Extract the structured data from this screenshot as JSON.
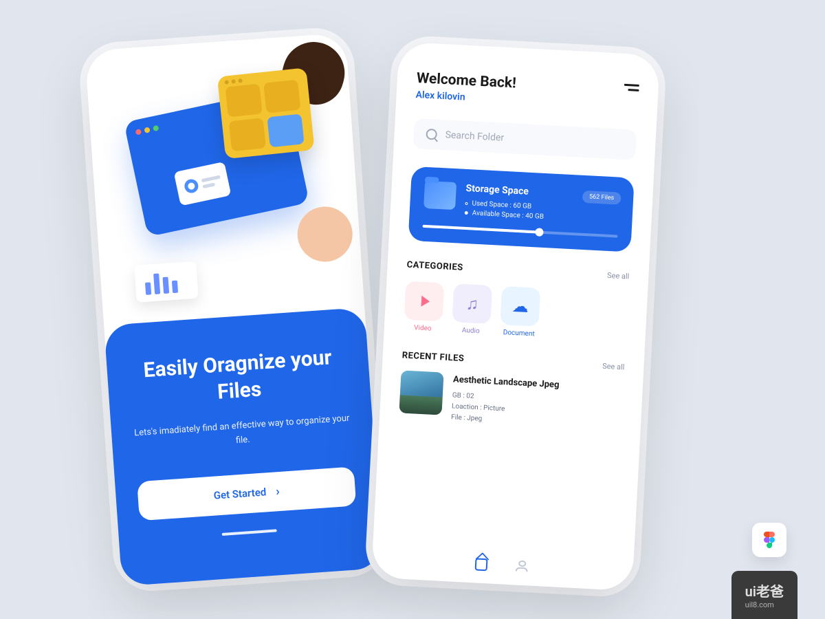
{
  "onboarding": {
    "title": "Easily Oragnize your Files",
    "subtitle": "Lets's imadiately find an effective way to organize your file.",
    "button_label": "Get Started"
  },
  "home": {
    "welcome": "Welcome Back!",
    "username": "Alex kilovin",
    "search_placeholder": "Search  Folder",
    "storage": {
      "title": "Storage Space",
      "used_label": "Used Space : 60 GB",
      "available_label": "Available Space : 40 GB",
      "badge": "562 Files",
      "percent": 60
    },
    "categories_title": "CATEGORIES",
    "see_all": "See all",
    "categories": [
      {
        "label": "Video"
      },
      {
        "label": "Audio"
      },
      {
        "label": "Document"
      }
    ],
    "recent_title": "RECENT FILES",
    "recent_file": {
      "name": "Aesthetic Landscape Jpeg",
      "size": "GB : 02",
      "location": "Loaction : Picture",
      "type": "File : Jpeg"
    }
  },
  "watermark": {
    "brand": "ui老爸",
    "url": "uil8.com"
  }
}
